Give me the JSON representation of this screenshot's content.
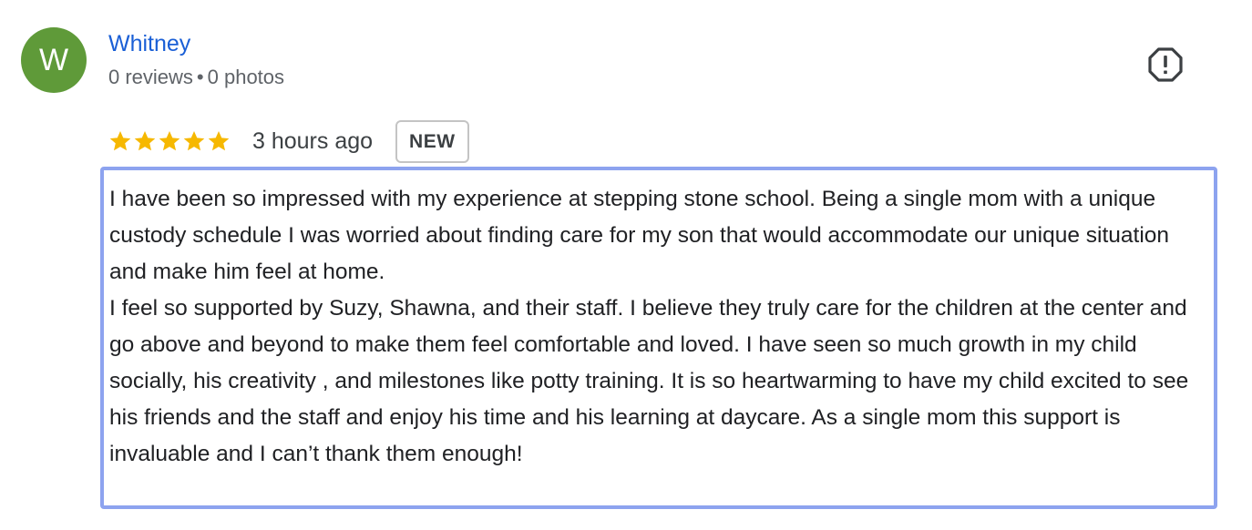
{
  "review": {
    "author": {
      "initial": "W",
      "name": "Whitney",
      "reviews": "0 reviews",
      "separator": "•",
      "photos": "0 photos",
      "avatar_color": "#5f9a39",
      "name_color": "#1a5fd6"
    },
    "flag_icon": "report-flag-icon",
    "rating": 5,
    "rating_max": 5,
    "star_color": "#f6b800",
    "timestamp": "3 hours ago",
    "badge": "NEW",
    "text": {
      "paragraph1": "I have been so impressed with my experience at stepping stone school. Being a single mom with a unique custody schedule I was worried about finding care for my son that would accommodate our unique situation and make him feel at home.",
      "paragraph2": "I feel so supported by Suzy, Shawna, and their staff. I believe they truly care for the children at the center and go above and beyond to make them feel comfortable and loved. I have seen so much growth in my child socially, his creativity , and milestones like potty training. It is so heartwarming to have my child excited to see his friends and the staff and enjoy his time and his learning at daycare. As a single mom this support is invaluable and I can’t thank them enough!"
    },
    "highlight_color": "#8da3ef"
  }
}
